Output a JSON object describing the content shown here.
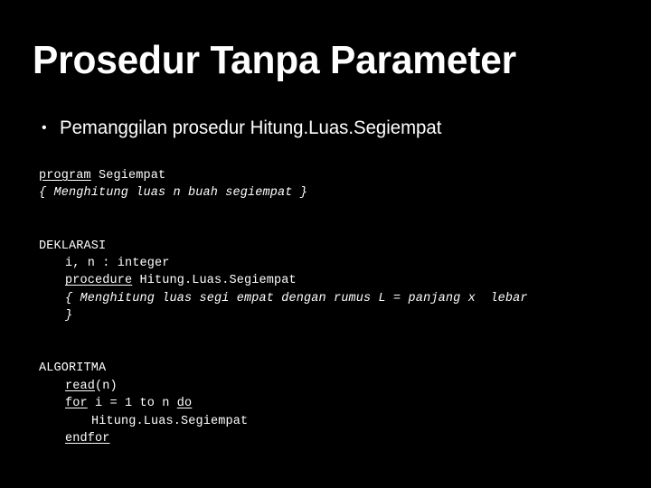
{
  "slide": {
    "background_color": "#000000",
    "text_color": "#ffffff",
    "title": "Prosedur Tanpa Parameter"
  },
  "bullets": [
    {
      "marker": "•",
      "text": "Pemanggilan prosedur Hitung.Luas.Segiempat"
    }
  ],
  "code": {
    "lines": [
      {
        "id": "l1",
        "indent": 1,
        "blank": false,
        "parts": [
          {
            "t": "program",
            "style": "keyword"
          },
          {
            "t": " Segiempat",
            "style": "plain"
          }
        ]
      },
      {
        "id": "l2",
        "indent": 1,
        "blank": false,
        "parts": [
          {
            "t": "{ Menghitung luas n buah segiempat }",
            "style": "comment"
          }
        ]
      },
      {
        "id": "l3",
        "indent": 1,
        "blank": true,
        "parts": []
      },
      {
        "id": "l4",
        "indent": 1,
        "blank": true,
        "parts": []
      },
      {
        "id": "l5",
        "indent": 1,
        "blank": false,
        "parts": [
          {
            "t": "DEKLARASI",
            "style": "plain"
          }
        ]
      },
      {
        "id": "l6",
        "indent": 2,
        "blank": false,
        "parts": [
          {
            "t": "i, n : integer",
            "style": "plain"
          }
        ]
      },
      {
        "id": "l7",
        "indent": 2,
        "blank": false,
        "parts": [
          {
            "t": "procedure",
            "style": "keyword"
          },
          {
            "t": " Hitung.Luas.Segiempat",
            "style": "plain"
          }
        ]
      },
      {
        "id": "l8",
        "indent": 2,
        "blank": false,
        "parts": [
          {
            "t": "{ Menghitung luas segi empat dengan rumus L = panjang x  lebar",
            "style": "comment"
          }
        ]
      },
      {
        "id": "l9",
        "indent": 2,
        "blank": false,
        "parts": [
          {
            "t": "}",
            "style": "comment"
          }
        ]
      },
      {
        "id": "l10",
        "indent": 1,
        "blank": true,
        "parts": []
      },
      {
        "id": "l11",
        "indent": 1,
        "blank": true,
        "parts": []
      },
      {
        "id": "l12",
        "indent": 1,
        "blank": false,
        "parts": [
          {
            "t": "ALGORITMA",
            "style": "plain"
          }
        ]
      },
      {
        "id": "l13",
        "indent": 2,
        "blank": false,
        "parts": [
          {
            "t": "read",
            "style": "keyword"
          },
          {
            "t": "(n)",
            "style": "plain"
          }
        ]
      },
      {
        "id": "l14",
        "indent": 2,
        "blank": false,
        "parts": [
          {
            "t": "for",
            "style": "keyword"
          },
          {
            "t": " i = 1 to n ",
            "style": "plain"
          },
          {
            "t": "do",
            "style": "keyword"
          }
        ]
      },
      {
        "id": "l15",
        "indent": 3,
        "blank": false,
        "parts": [
          {
            "t": "Hitung.Luas.Segiempat",
            "style": "plain"
          }
        ]
      },
      {
        "id": "l16",
        "indent": 2,
        "blank": false,
        "parts": [
          {
            "t": "endfor",
            "style": "keyword"
          }
        ]
      }
    ]
  }
}
